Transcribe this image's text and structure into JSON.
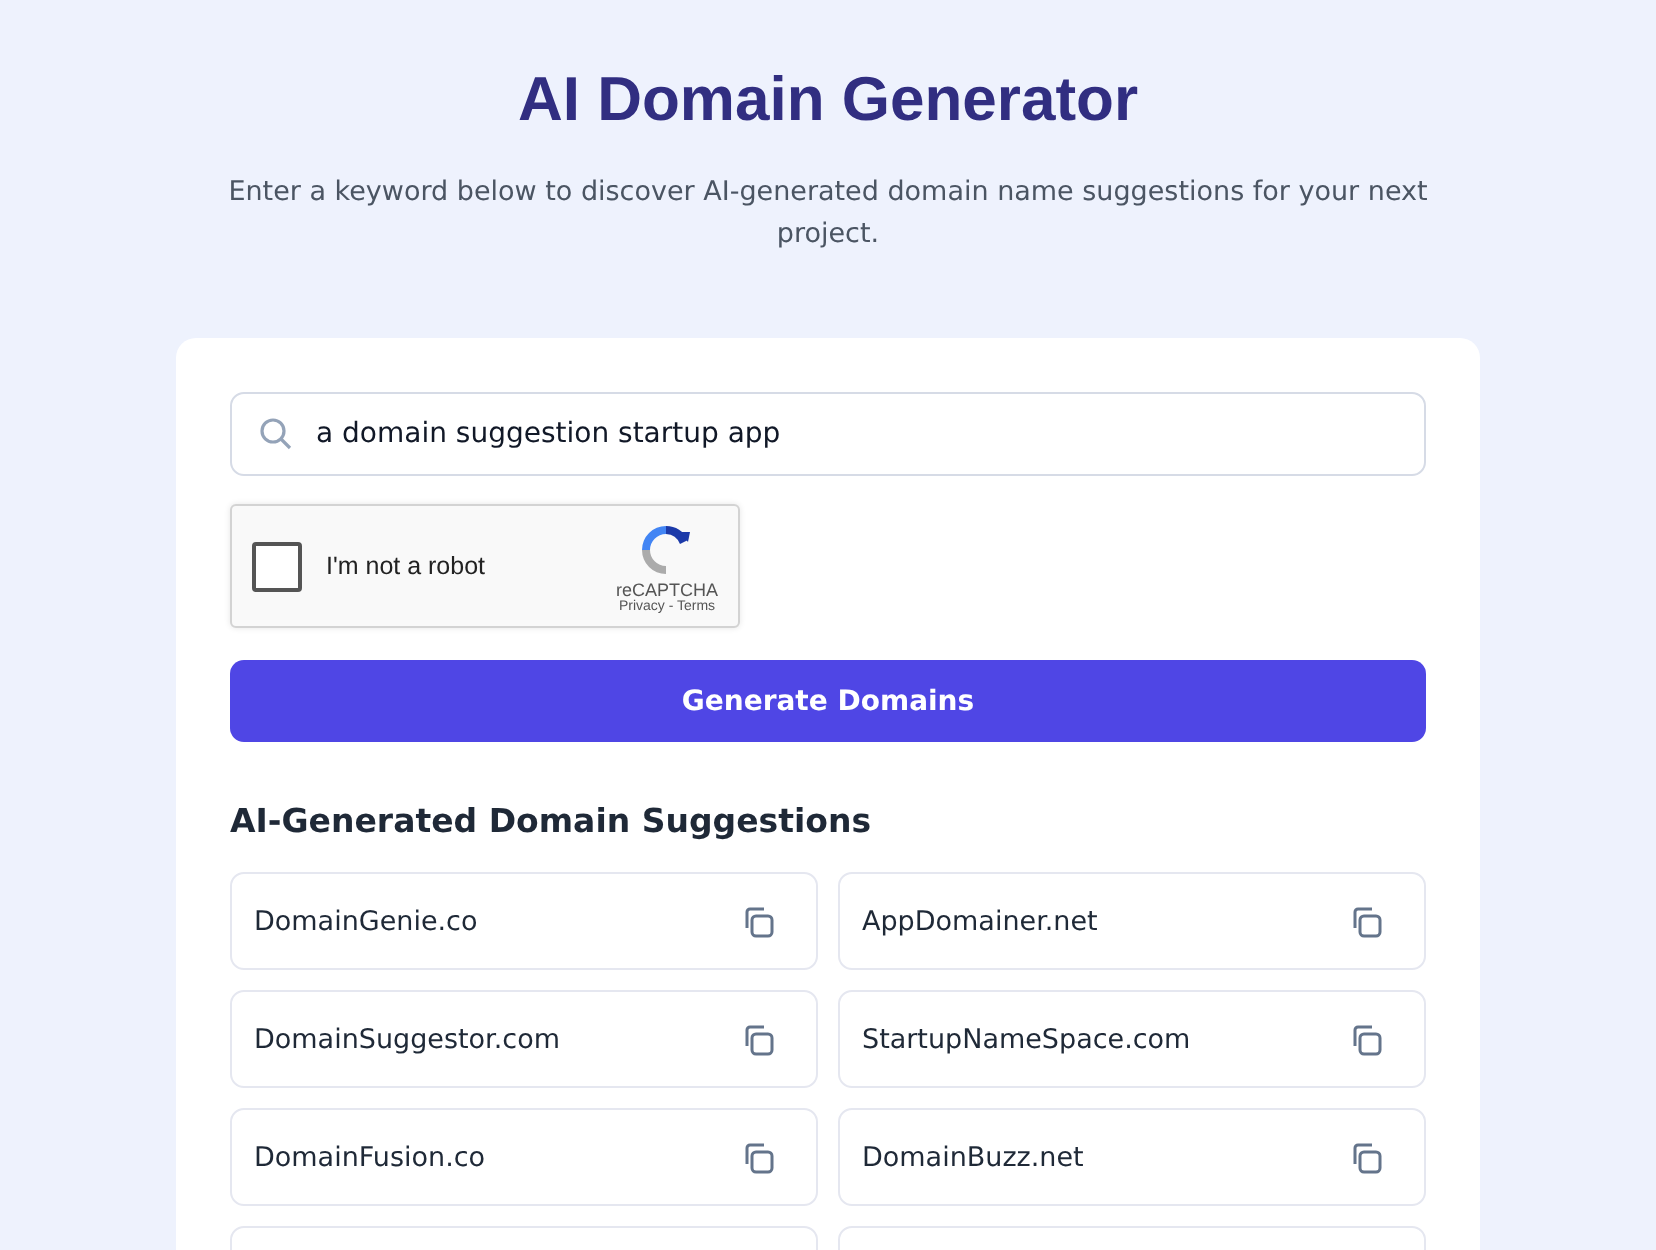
{
  "header": {
    "title": "AI Domain Generator",
    "subtitle": "Enter a keyword below to discover AI-generated domain name suggestions for your next project."
  },
  "search": {
    "value": "a domain suggestion startup app"
  },
  "captcha": {
    "label": "I'm not a robot",
    "checked": false,
    "brand": "reCAPTCHA",
    "links": "Privacy - Terms"
  },
  "generate_button": "Generate Domains",
  "suggestions": {
    "heading": "AI-Generated Domain Suggestions",
    "items": [
      {
        "name": "DomainGenie.co"
      },
      {
        "name": "AppDomainer.net"
      },
      {
        "name": "DomainSuggestor.com"
      },
      {
        "name": "StartupNameSpace.com"
      },
      {
        "name": "DomainFusion.co"
      },
      {
        "name": "DomainBuzz.net"
      }
    ]
  }
}
